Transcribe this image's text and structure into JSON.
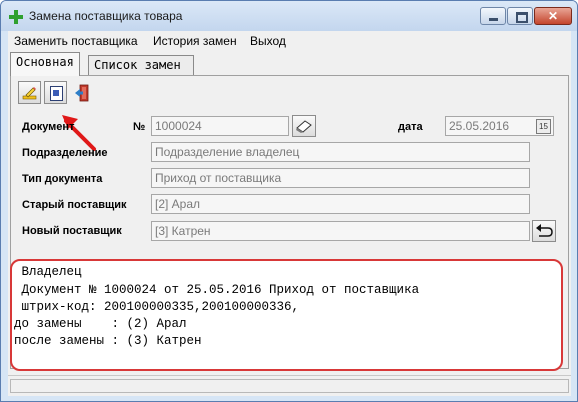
{
  "window": {
    "title": "Замена поставщика товара",
    "accent_color": "#2fa02f"
  },
  "menu": {
    "items": [
      "Заменить поставщика",
      "История замен",
      "Выход"
    ]
  },
  "tabs": [
    {
      "label": "Основная",
      "active": true
    },
    {
      "label": "Список замен",
      "active": false
    }
  ],
  "toolbar": {
    "buttons": [
      {
        "icon": "pencil-icon"
      },
      {
        "icon": "report-icon"
      },
      {
        "icon": "exit-icon"
      }
    ]
  },
  "form": {
    "document_label": "Документ",
    "number_label": "№",
    "document_number": "1000024",
    "date_label": "дата",
    "date_value": "25.05.2016",
    "calendar_label": "15",
    "division_label": "Подразделение",
    "division_value": "Подразделение владелец",
    "doc_type_label": "Тип документа",
    "doc_type_value": "Приход от поставщика",
    "old_supplier_label": "Старый поставщик",
    "old_supplier_value": "[2] Арал",
    "new_supplier_label": "Новый поставщик",
    "new_supplier_value": "[3] Катрен"
  },
  "log": {
    "lines": [
      " Владелец",
      " Документ № 1000024 от 25.05.2016 Приход от поставщика",
      " штрих-код: 200100000335,200100000336,",
      "до замены    : (2) Арал",
      "после замены : (3) Катрен"
    ],
    "highlight_color": "#d83838"
  }
}
